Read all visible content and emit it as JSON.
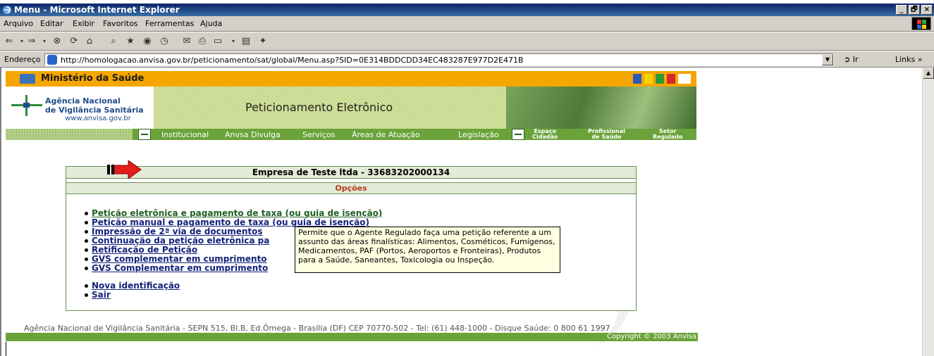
{
  "window": {
    "title": "Menu - Microsoft Internet Explorer",
    "minimize": "_",
    "maximize": "🗗",
    "close": "×"
  },
  "menu": {
    "items": [
      {
        "label": "Arquivo"
      },
      {
        "label": "Editar"
      },
      {
        "label": "Exibir"
      },
      {
        "label": "Favoritos"
      },
      {
        "label": "Ferramentas"
      },
      {
        "label": "Ajuda"
      }
    ]
  },
  "address": {
    "label": "Endereço",
    "url": "http://homologacao.anvisa.gov.br/peticionamento/sat/global/Menu.asp?SID=0E314BDDCDD34EC483287E977D2E471B",
    "go_label": "Ir",
    "links_label": "Links »"
  },
  "page": {
    "ministry": "Ministério da Saúde",
    "brand": {
      "line1": "Agência Nacional",
      "line2": "de Vigilância Sanitária",
      "url": "www.anvisa.gov.br"
    },
    "banner_title": "Peticionamento Eletrônico",
    "nav": [
      {
        "label": "Institucional"
      },
      {
        "label": "Anvsa Divulga"
      },
      {
        "label": "Serviços"
      },
      {
        "label": "Áreas de Atuação"
      },
      {
        "label": "Legislação"
      }
    ],
    "nav_small": [
      {
        "line1": "Espaço",
        "line2": "Cidadão"
      },
      {
        "line1": "Profissional",
        "line2": "de Saúde"
      },
      {
        "line1": "Setor",
        "line2": "Regulado"
      }
    ],
    "company": "Empresa de Teste ltda - 33683202000134",
    "opcoes_header": "Opções",
    "options": [
      {
        "label": "Petição eletrônica e pagamento de taxa (ou guia de isenção)"
      },
      {
        "label": "Petição manual e pagamento de taxa (ou guia de isenção)"
      },
      {
        "label": "Impressão de 2ª via de documentos"
      },
      {
        "label": "Continuação da petição eletrônica pa"
      },
      {
        "label": "Retificação de Petição"
      },
      {
        "label": "GVS complementar em cumprimento"
      },
      {
        "label": "GVS Complementar em cumprimento"
      }
    ],
    "options2": [
      {
        "label": "Nova identificação"
      },
      {
        "label": "Sair"
      }
    ],
    "tooltip": "Permite que o Agente Regulado faça uma petição referente a um assunto das áreas finalísticas: Alimentos, Cosméticos, Fumígenos, Medicamentos, PAF (Portos, Aeroportos e Fronteiras), Produtos para a Saúde, Saneantes, Toxicologia ou Inspeção.",
    "footer": "Agência Nacional de Vigilância Sanitária - SEPN 515, Bl.B, Ed.Ômega - Brasília (DF) CEP 70770-502 - Tel: (61) 448-1000 - Disque Saúde: 0 800 61 1997",
    "copyright": "Copyright © 2003 Anvisa"
  },
  "colors": {
    "ministry_bar": "#f6a600",
    "nav_green": "#6ba33a",
    "option_link": "#13237a",
    "tooltip_bg": "#ffffe1"
  }
}
